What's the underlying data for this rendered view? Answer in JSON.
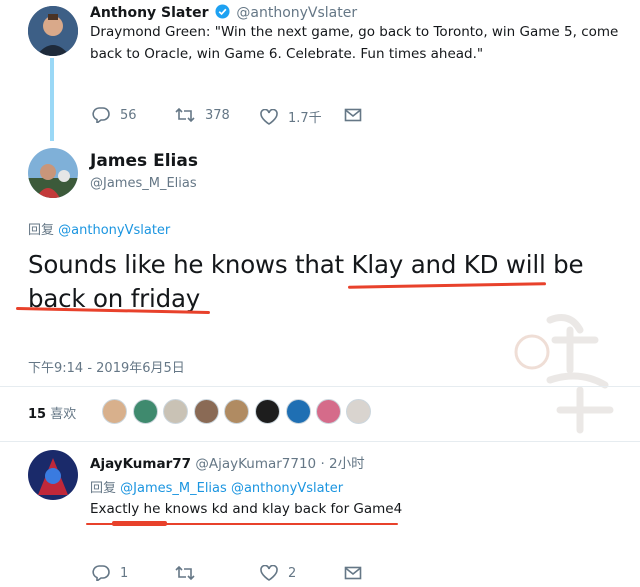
{
  "tweet1": {
    "name": "Anthony Slater",
    "handle": "@anthonyVslater",
    "text_line1": "Draymond Green: \"Win the next game, go back to Toronto, win Game 5, come",
    "text_line2": "back to Oracle, win Game 6. Celebrate. Fun times ahead.\"",
    "actions": {
      "replies": "56",
      "retweets": "378",
      "likes": "1.7千"
    }
  },
  "tweet2": {
    "name": "James Elias",
    "handle": "@James_M_Elias",
    "reply_prefix": "回复",
    "reply_to": "@anthonyVslater",
    "text_line1": "Sounds like he knows that Klay and KD will be",
    "text_line2": "back on friday",
    "timestamp": "下午9:14 - 2019年6月5日",
    "likes_count": "15",
    "likes_label": "喜欢"
  },
  "tweet3": {
    "name": "AjayKumar77",
    "handle": "@AjayKumar7710",
    "time": "· 2小时",
    "reply_prefix": "回复",
    "reply_to1": "@James_M_Elias",
    "reply_to2": "@anthonyVslater",
    "text": "Exactly he knows kd and klay back for Game4",
    "actions": {
      "replies": "1",
      "likes": "2"
    }
  },
  "colors": {
    "accent": "#1b95e0",
    "underline": "#e8412b",
    "thread_line": "#9ad8f6"
  }
}
